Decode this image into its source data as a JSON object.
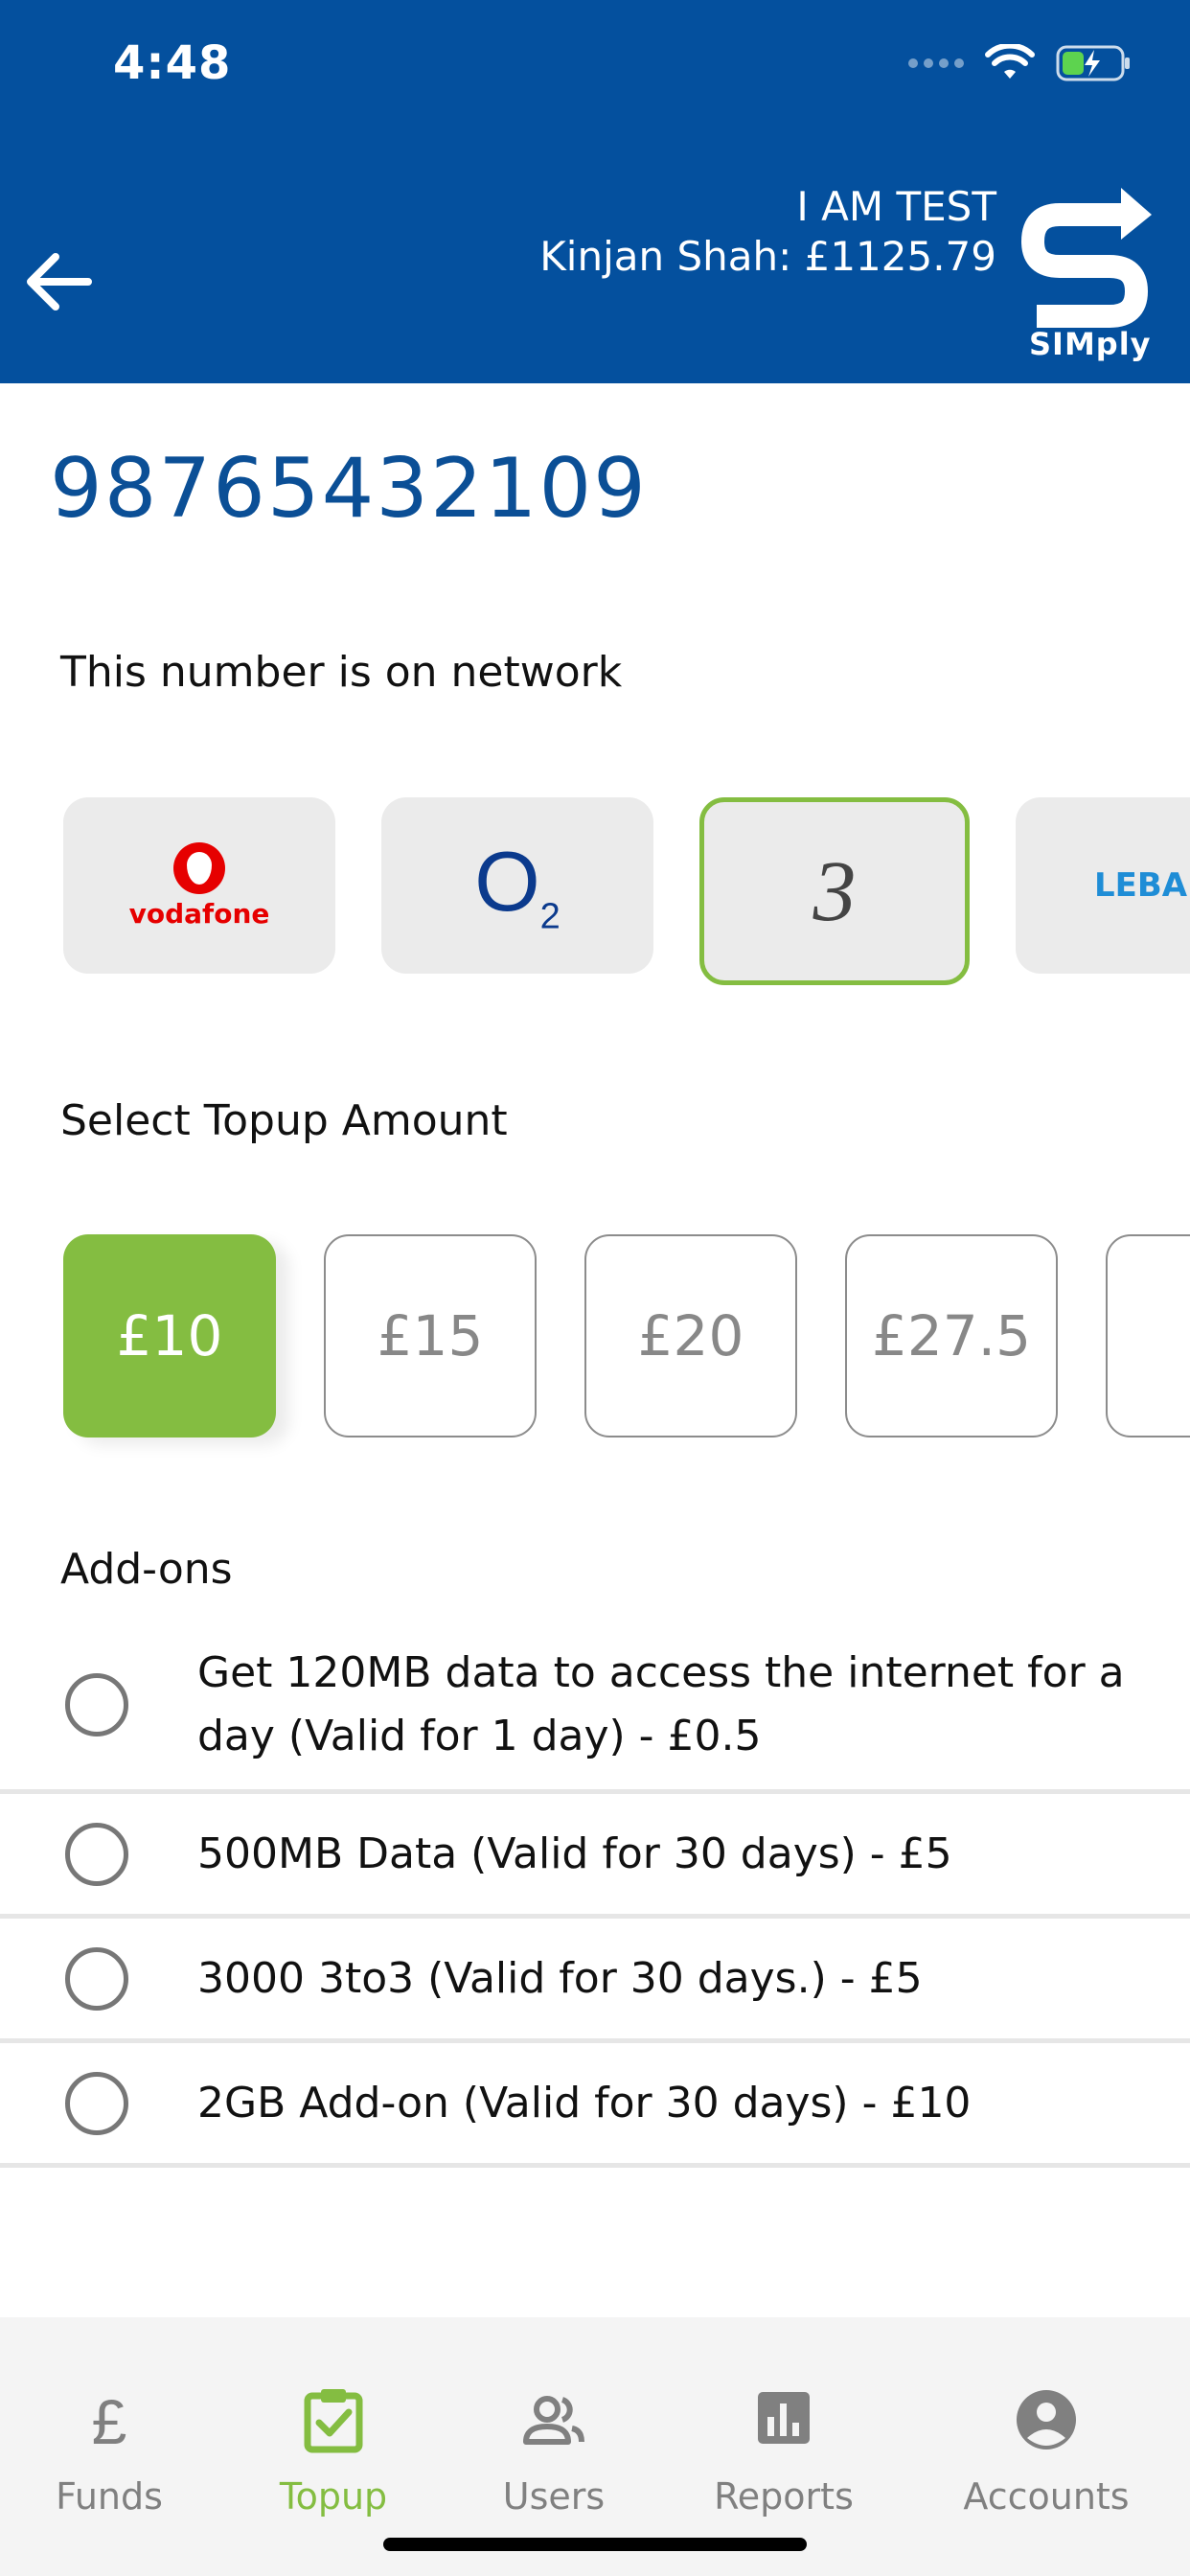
{
  "status_bar": {
    "time": "4:48"
  },
  "header": {
    "account_name": "I AM TEST",
    "balance_line": "Kinjan Shah: £1125.79",
    "logo_text": "SIMply"
  },
  "phone_number": "98765432109",
  "network_section": {
    "title": "This number is on network",
    "networks": [
      {
        "name": "vodafone",
        "label": "vodafone",
        "selected": false
      },
      {
        "name": "O2",
        "label": "O",
        "sub": "2",
        "selected": false
      },
      {
        "name": "Three",
        "label": "3",
        "selected": true
      },
      {
        "name": "Lebara",
        "label": "LEBAR",
        "selected": false
      }
    ]
  },
  "amount_section": {
    "title": "Select Topup Amount",
    "amounts": [
      "£10",
      "£15",
      "£20",
      "£27.5",
      "£"
    ],
    "selected_index": 0
  },
  "addons": {
    "title": "Add-ons",
    "items": [
      "Get 120MB data to access the internet for a day (Valid for 1 day) - £0.5",
      "500MB Data (Valid for 30 days) - £5",
      "3000 3to3 (Valid for 30 days.) - £5",
      "2GB Add-on (Valid for 30 days) - £10"
    ]
  },
  "tabbar": {
    "tabs": [
      {
        "label": "Funds",
        "icon": "pound-icon",
        "active": false
      },
      {
        "label": "Topup",
        "icon": "clipboard-check-icon",
        "active": true
      },
      {
        "label": "Users",
        "icon": "users-icon",
        "active": false
      },
      {
        "label": "Reports",
        "icon": "bar-chart-icon",
        "active": false
      },
      {
        "label": "Accounts",
        "icon": "account-circle-icon",
        "active": false
      }
    ]
  },
  "colors": {
    "header_bg": "#04509e",
    "accent_green": "#84bd41",
    "phone_number_blue": "#0b4f96"
  }
}
